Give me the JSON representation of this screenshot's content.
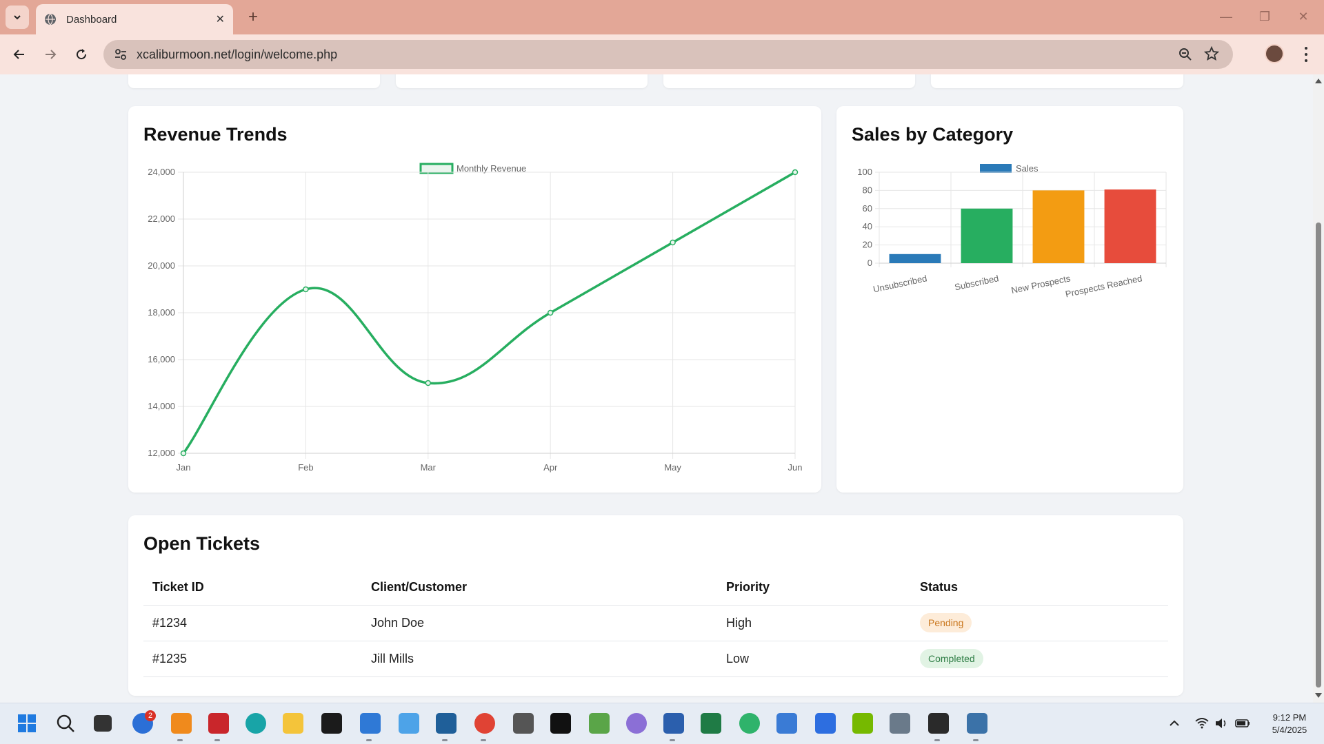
{
  "browser": {
    "tab_title": "Dashboard",
    "url": "xcaliburmoon.net/login/welcome.php"
  },
  "revenue_card": {
    "title": "Revenue Trends"
  },
  "category_card": {
    "title": "Sales by Category"
  },
  "chart_data": [
    {
      "type": "line",
      "title": "Revenue Trends",
      "x": [
        "Jan",
        "Feb",
        "Mar",
        "Apr",
        "May",
        "Jun"
      ],
      "series": [
        {
          "name": "Monthly Revenue",
          "values": [
            12000,
            19000,
            15000,
            18000,
            21000,
            24000
          ],
          "color": "#27ae60"
        }
      ],
      "ylim": [
        12000,
        24000
      ],
      "yticks": [
        "24,000",
        "22,000",
        "20,000",
        "18,000",
        "16,000",
        "14,000",
        "12,000"
      ],
      "legend": "top",
      "grid": true
    },
    {
      "type": "bar",
      "title": "Sales by Category",
      "categories": [
        "Unsubscribed",
        "Subscribed",
        "New Prospects",
        "Prospects Reached"
      ],
      "series": [
        {
          "name": "Sales",
          "values": [
            10,
            60,
            80,
            81
          ],
          "colors": [
            "#2a7ab8",
            "#27ae60",
            "#f39c12",
            "#e74c3c"
          ]
        }
      ],
      "ylim": [
        0,
        100
      ],
      "yticks": [
        "100",
        "80",
        "60",
        "40",
        "20",
        "0"
      ],
      "legend": "top",
      "grid": true
    }
  ],
  "tickets": {
    "title": "Open Tickets",
    "headers": [
      "Ticket ID",
      "Client/Customer",
      "Priority",
      "Status"
    ],
    "rows": [
      {
        "id": "#1234",
        "client": "John Doe",
        "priority": "High",
        "status": "Pending"
      },
      {
        "id": "#1235",
        "client": "Jill Mills",
        "priority": "Low",
        "status": "Completed"
      }
    ]
  },
  "taskbar": {
    "notification_count": "2",
    "time": "9:12 PM",
    "date": "5/4/2025"
  }
}
